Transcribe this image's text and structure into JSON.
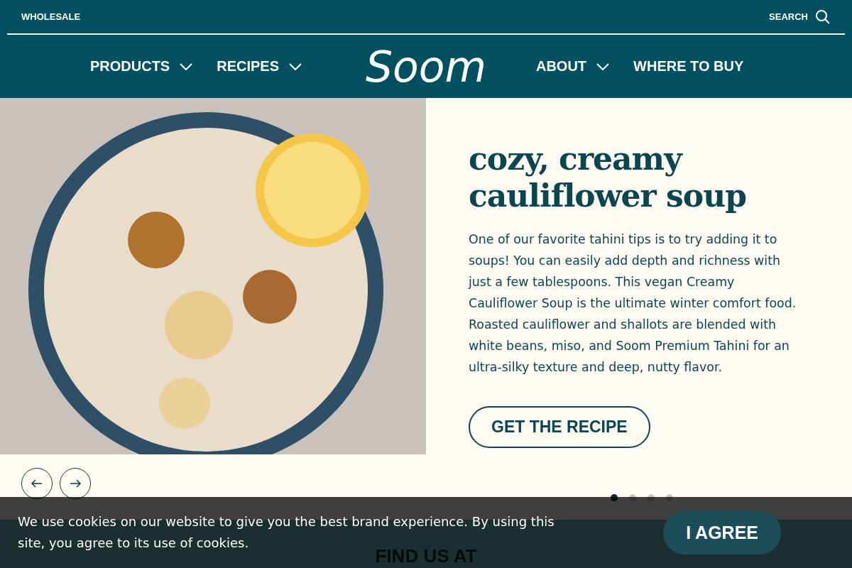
{
  "utility_bar": {
    "wholesale_link": "WHOLESALE",
    "search_label": "SEARCH"
  },
  "nav": {
    "left_items": [
      {
        "label": "PRODUCTS",
        "has_dropdown": true
      },
      {
        "label": "RECIPES",
        "has_dropdown": true
      }
    ],
    "logo": "Soom",
    "right_items": [
      {
        "label": "ABOUT",
        "has_dropdown": true
      },
      {
        "label": "WHERE TO BUY",
        "has_dropdown": false
      }
    ]
  },
  "hero": {
    "title": "cozy, creamy cauliflower soup",
    "body": "One of our favorite tahini tips is to try adding it to soups! You can easily add depth and richness with just a few tablespoons. This vegan Creamy Cauliflower Soup is the ultimate winter comfort food. Roasted cauliflower and shallots are blended with white beans, miso, and Soom Premium Tahini for an ultra-silky texture and deep, nutty flavor.",
    "button": "GET THE RECIPE"
  },
  "carousel_dots": [
    {
      "selected": true
    },
    {
      "selected": false
    },
    {
      "selected": false
    },
    {
      "selected": false
    }
  ],
  "next_section": {
    "heading": "FIND US AT"
  },
  "cookie_banner": {
    "text": "We use cookies on our website to give you the best brand experience. By using this site, you agree to its use of cookies.",
    "button": "I AGREE"
  }
}
